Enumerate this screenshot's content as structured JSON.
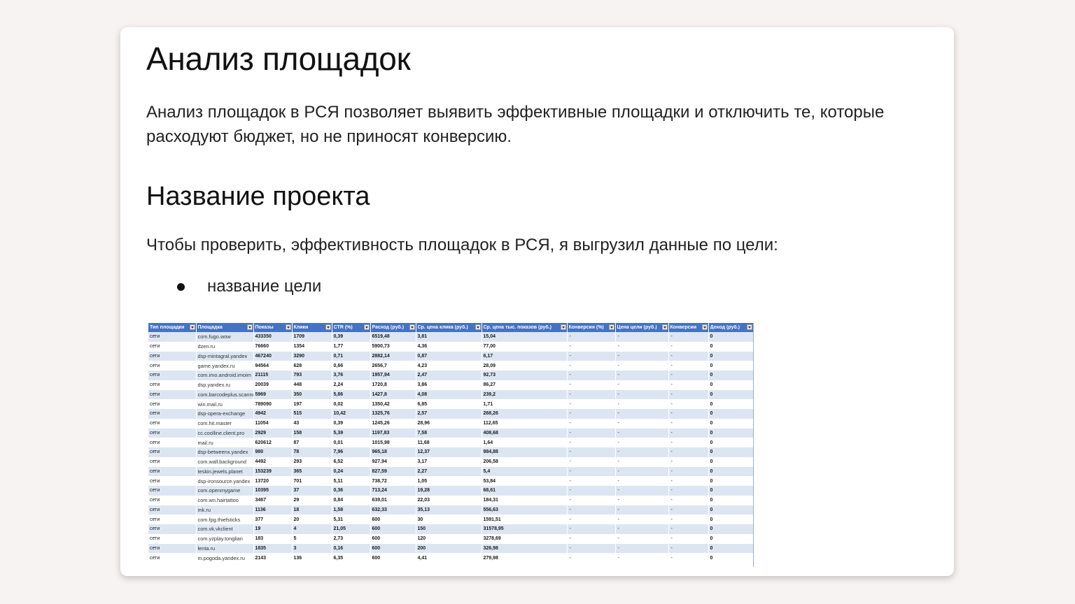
{
  "title": "Анализ площадок",
  "intro": "Анализ площадок в РСЯ позволяет выявить эффективные площадки и отключить те, которые расходуют бюджет, но не приносят конверсию.",
  "project_title": "Название проекта",
  "lead": "Чтобы проверить, эффективность площадок в РСЯ, я выгрузил данные по цели:",
  "bullets": [
    "название цели"
  ],
  "sheet": {
    "columns": [
      "Тип площадки",
      "Площадка",
      "Показы",
      "Клики",
      "CTR (%)",
      "Расход (руб.)",
      "Ср. цена клика (руб.)",
      "Ср. цена тыс. показов (руб.)",
      "Конверсия (%)",
      "Цена цели (руб.)",
      "Конверсии",
      "Доход (руб.)"
    ],
    "rows": [
      [
        "сети",
        "com.fugo.wow",
        "433350",
        "1709",
        "0,39",
        "6519,48",
        "3,81",
        "15,04",
        "-",
        "-",
        "-",
        "0"
      ],
      [
        "сети",
        "dzen.ru",
        "76660",
        "1354",
        "1,77",
        "5900,73",
        "4,36",
        "77,00",
        "-",
        "-",
        "-",
        "0"
      ],
      [
        "сети",
        "dsp-mintagral.yandex",
        "467240",
        "3290",
        "0,71",
        "2882,14",
        "0,87",
        "6,17",
        "-",
        "-",
        "-",
        "0"
      ],
      [
        "сети",
        "game.yandex.ru",
        "94564",
        "628",
        "0,66",
        "2656,7",
        "4,23",
        "28,09",
        "-",
        "-",
        "-",
        "0"
      ],
      [
        "сети",
        "com.imo.android.imoim",
        "21115",
        "793",
        "3,76",
        "1957,94",
        "2,47",
        "92,73",
        "-",
        "-",
        "-",
        "0"
      ],
      [
        "сети",
        "dsp.yandex.ru",
        "20039",
        "448",
        "2,24",
        "1720,8",
        "3,86",
        "86,27",
        "-",
        "-",
        "-",
        "0"
      ],
      [
        "сети",
        "com.barcodeplus.scanner",
        "5969",
        "350",
        "5,86",
        "1427,8",
        "4,08",
        "239,2",
        "-",
        "-",
        "-",
        "0"
      ],
      [
        "сети",
        "win.mail.ru",
        "789090",
        "197",
        "0,02",
        "1350,42",
        "6,85",
        "1,71",
        "-",
        "-",
        "-",
        "0"
      ],
      [
        "сети",
        "dsp-opera-exchange",
        "4942",
        "515",
        "10,42",
        "1325,76",
        "2,57",
        "268,26",
        "-",
        "-",
        "-",
        "0"
      ],
      [
        "сети",
        "com.hit.master",
        "11054",
        "43",
        "0,39",
        "1245,26",
        "28,96",
        "112,65",
        "-",
        "-",
        "-",
        "0"
      ],
      [
        "сети",
        "cc.coolline.client.pro",
        "2929",
        "158",
        "5,39",
        "1197,83",
        "7,58",
        "408,68",
        "-",
        "-",
        "-",
        "0"
      ],
      [
        "сети",
        "mail.ru",
        "620612",
        "87",
        "0,01",
        "1015,98",
        "11,68",
        "1,64",
        "-",
        "-",
        "-",
        "0"
      ],
      [
        "сети",
        "dsp-betweenx.yandex",
        "980",
        "78",
        "7,96",
        "965,18",
        "12,37",
        "984,88",
        "-",
        "-",
        "-",
        "0"
      ],
      [
        "сети",
        "com.wall.background",
        "4492",
        "293",
        "6,52",
        "927,94",
        "3,17",
        "206,58",
        "-",
        "-",
        "-",
        "0"
      ],
      [
        "сети",
        "teskin.jewels.planet",
        "153239",
        "365",
        "0,24",
        "827,59",
        "2,27",
        "5,4",
        "-",
        "-",
        "-",
        "0"
      ],
      [
        "сети",
        "dsp-ironsource.yandex",
        "13720",
        "701",
        "5,11",
        "738,72",
        "1,05",
        "53,84",
        "-",
        "-",
        "-",
        "0"
      ],
      [
        "сети",
        "com.openmygame",
        "10395",
        "37",
        "0,36",
        "713,24",
        "19,28",
        "68,61",
        "-",
        "-",
        "-",
        "0"
      ],
      [
        "сети",
        "com.wn.hairtattoo",
        "3467",
        "29",
        "0,84",
        "639,01",
        "22,03",
        "184,31",
        "-",
        "-",
        "-",
        "0"
      ],
      [
        "сети",
        "mk.ru",
        "1136",
        "18",
        "1,58",
        "632,33",
        "35,13",
        "556,63",
        "-",
        "-",
        "-",
        "0"
      ],
      [
        "сети",
        "com.fpg.thiefsticks",
        "377",
        "20",
        "5,31",
        "600",
        "30",
        "1591,51",
        "-",
        "-",
        "-",
        "0"
      ],
      [
        "сети",
        "com.vk.vkclient",
        "19",
        "4",
        "21,05",
        "600",
        "150",
        "31578,95",
        "-",
        "-",
        "-",
        "0"
      ],
      [
        "сети",
        "com.yzplay.tonglian",
        "183",
        "5",
        "2,73",
        "600",
        "120",
        "3278,69",
        "-",
        "-",
        "-",
        "0"
      ],
      [
        "сети",
        "lenta.ru",
        "1835",
        "3",
        "0,16",
        "600",
        "200",
        "326,98",
        "-",
        "-",
        "-",
        "0"
      ],
      [
        "сети",
        "m.pogoda.yandex.ru",
        "2143",
        "136",
        "6,35",
        "600",
        "4,41",
        "279,98",
        "-",
        "-",
        "-",
        "0"
      ]
    ]
  }
}
